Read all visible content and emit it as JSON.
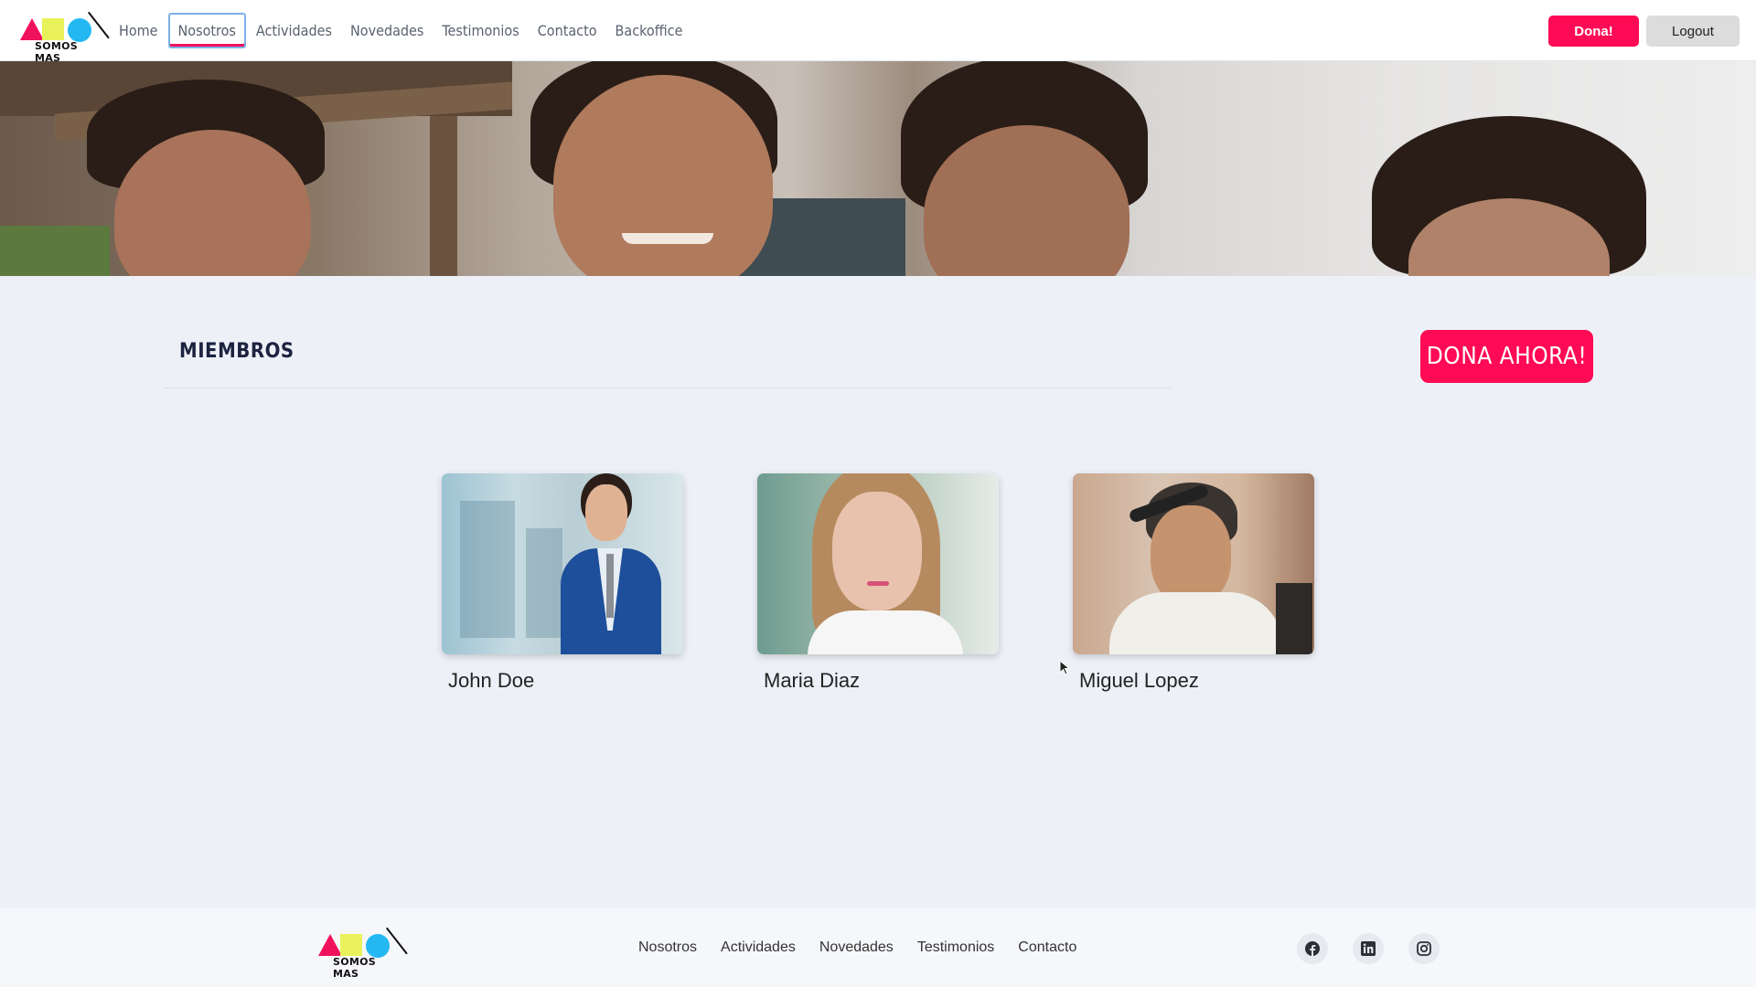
{
  "brand": {
    "logo_text": "SOMOS MAS"
  },
  "nav": {
    "links": [
      "Home",
      "Nosotros",
      "Actividades",
      "Novedades",
      "Testimonios",
      "Contacto",
      "Backoffice"
    ],
    "active": "Nosotros",
    "dona_button": "Dona!",
    "logout_button": "Logout"
  },
  "main": {
    "title": "MIEMBROS",
    "cta_button": "DONA AHORA!",
    "members": [
      {
        "name": "John Doe"
      },
      {
        "name": "Maria Diaz"
      },
      {
        "name": "Miguel Lopez"
      }
    ]
  },
  "footer": {
    "logo_text": "SOMOS MAS",
    "links": [
      "Nosotros",
      "Actividades",
      "Novedades",
      "Testimonios",
      "Contacto"
    ],
    "social": [
      "facebook-icon",
      "linkedin-icon",
      "instagram-icon"
    ]
  },
  "colors": {
    "accent": "#ff0a54",
    "background": "#edf1f7",
    "footer": "#f5f7fa"
  }
}
